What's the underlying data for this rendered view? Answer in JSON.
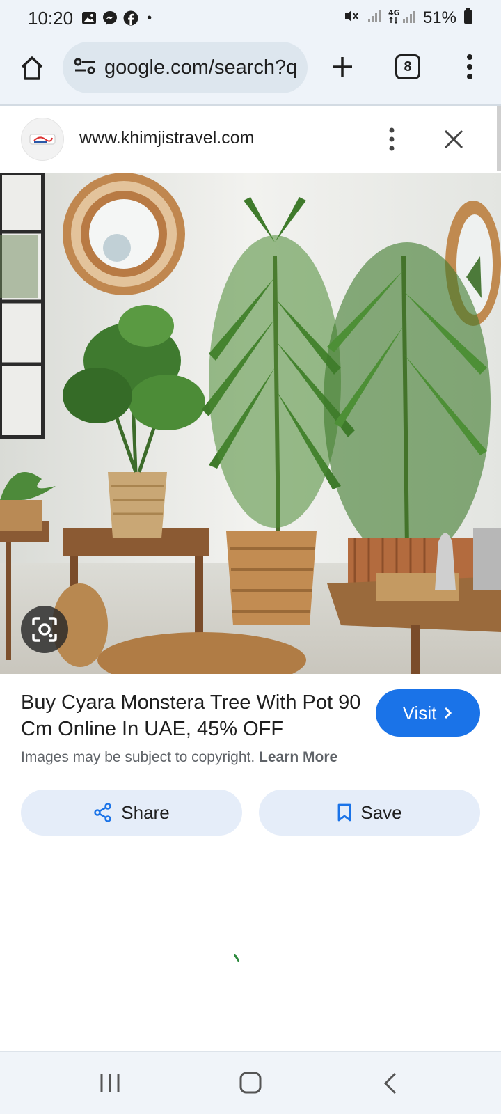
{
  "status_bar": {
    "time": "10:20",
    "battery": "51%",
    "network": "4G",
    "icons": [
      "gallery-icon",
      "messenger-icon",
      "facebook-icon",
      "notification-dot",
      "mute-icon",
      "signal-icon",
      "signal-4g-icon",
      "battery-icon"
    ]
  },
  "browser": {
    "url": "google.com/search?q",
    "tab_count": "8",
    "icons": [
      "home-icon",
      "site-settings-icon",
      "plus-icon",
      "tabs-icon",
      "more-vert-icon"
    ]
  },
  "source": {
    "domain": "www.khimjistravel.com",
    "icons": [
      "favicon",
      "more-vert-icon",
      "close-icon"
    ]
  },
  "result": {
    "title": "Buy Cyara Monstera Tree With Pot 90 Cm Online In UAE, 45% OFF",
    "visit_label": "Visit",
    "copyright_text": "Images may be subject to copyright.",
    "learn_more": "Learn More",
    "share_label": "Share",
    "save_label": "Save"
  },
  "colors": {
    "accent": "#1a73e8",
    "toolbar_bg": "#eef3f9",
    "action_bg": "#e5edf9"
  }
}
